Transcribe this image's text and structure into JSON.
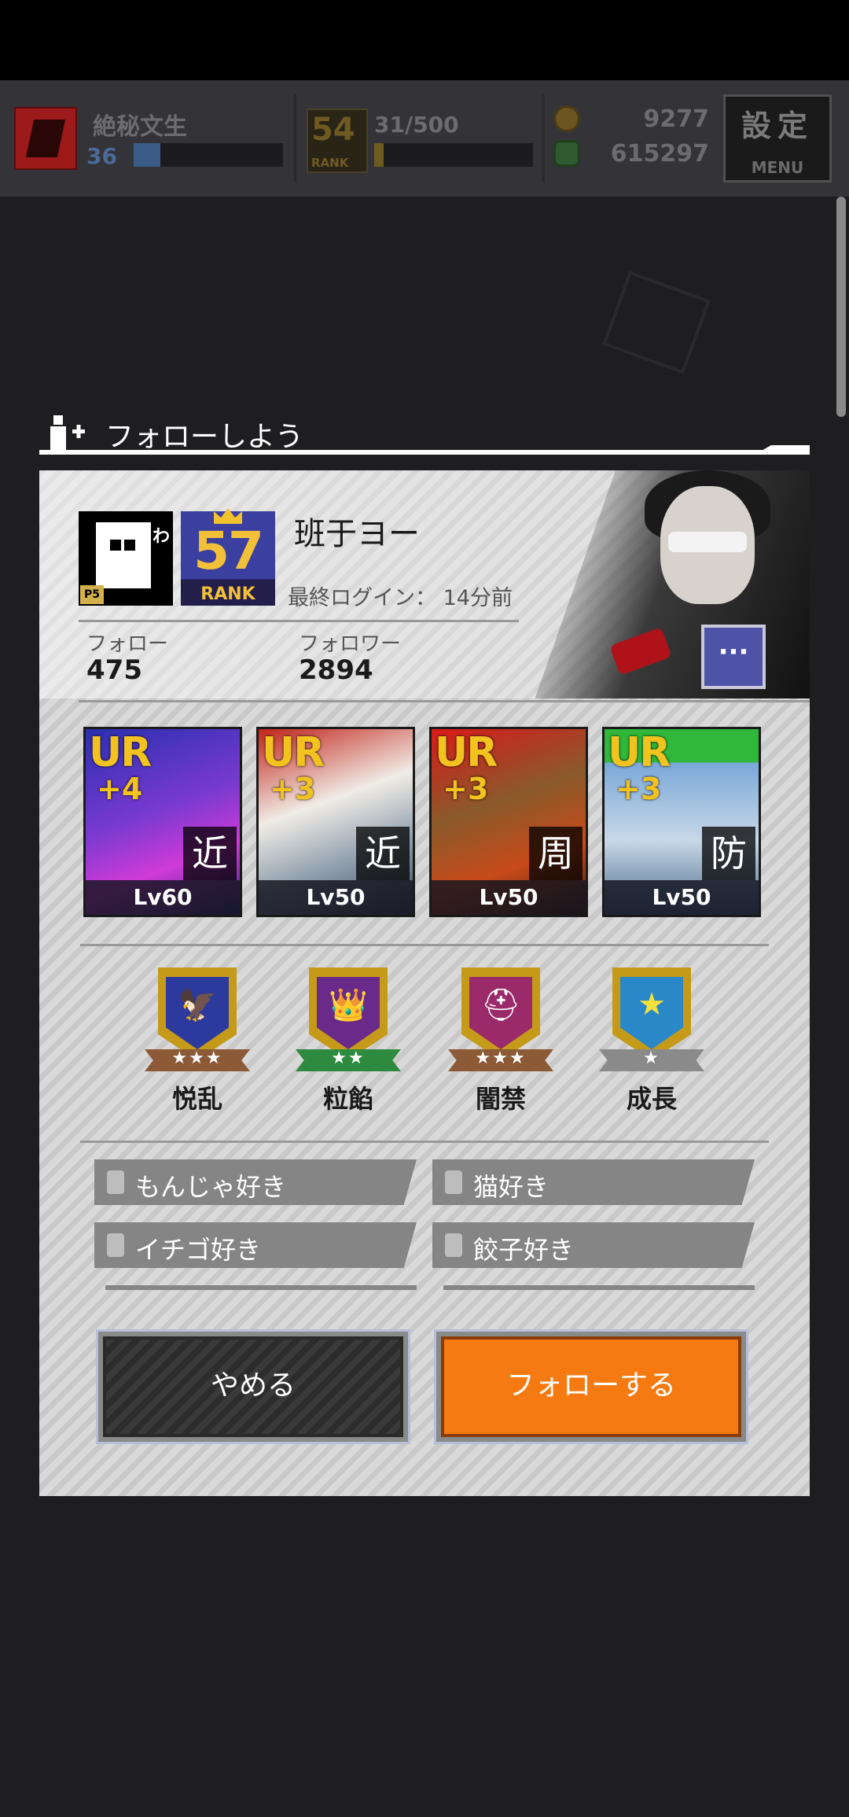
{
  "topbar": {
    "player_name": "絶秘文生",
    "player_level": "36",
    "rank": "54",
    "rank_label": "RANK",
    "stamina": "31/500",
    "coins": "9277",
    "money": "615297",
    "menu_kanji": "設定",
    "menu_label": "MENU"
  },
  "dialog": {
    "title": "フォローしよう",
    "player": {
      "avatar_char": "わ",
      "avatar_badge": "P5",
      "rank": "57",
      "rank_label": "RANK",
      "name": "班于ヨー",
      "last_login": "最終ログイン： 14分前",
      "follow_label": "フォロー",
      "follow_count": "475",
      "follower_label": "フォロワー",
      "follower_count": "2894",
      "more_icon": "ellipsis-icon"
    },
    "cards": [
      {
        "rarity": "UR",
        "plus": "+4",
        "type": "近",
        "level": "Lv60"
      },
      {
        "rarity": "UR",
        "plus": "+3",
        "type": "近",
        "level": "Lv50"
      },
      {
        "rarity": "UR",
        "plus": "+3",
        "type": "周",
        "level": "Lv50"
      },
      {
        "rarity": "UR",
        "plus": "+3",
        "type": "防",
        "level": "Lv50"
      }
    ],
    "emblems": [
      {
        "name": "悦乱",
        "stars": "★★★",
        "ribbon": "#8c5a36",
        "inner": "#2b3a9c",
        "glyph": "🦅"
      },
      {
        "name": "粒餡",
        "stars": "★★",
        "ribbon": "#2e8a3e",
        "inner": "#6a2a8a",
        "glyph": "👑"
      },
      {
        "name": "闇禁",
        "stars": "★★★",
        "ribbon": "#8c5a36",
        "inner": "#9a2a6a",
        "glyph": "⛑"
      },
      {
        "name": "成長",
        "stars": "★",
        "ribbon": "#8a8a8a",
        "inner": "#2a88c8",
        "glyph": "★"
      }
    ],
    "tags": [
      "もんじゃ好き",
      "猫好き",
      "イチゴ好き",
      "餃子好き"
    ],
    "cancel_label": "やめる",
    "follow_label": "フォローする"
  },
  "colors": {
    "accent_orange": "#f57a12",
    "rank_gold": "#f3c03a",
    "panel_bg": "#d0d0d0"
  }
}
